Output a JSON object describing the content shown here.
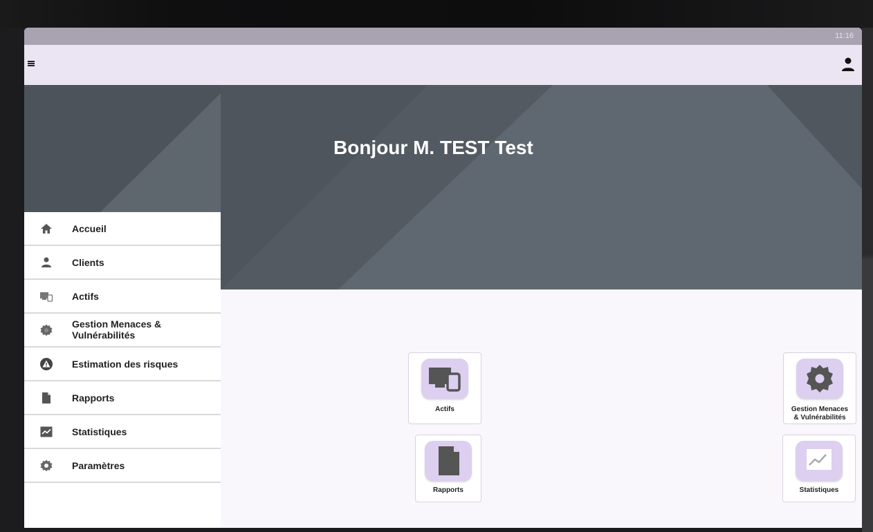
{
  "status_bar": {
    "time": "11:16"
  },
  "app_bar": {
    "menu_icon": "hamburger-menu-icon",
    "account_icon": "account-icon"
  },
  "hero": {
    "greeting": "Bonjour M. TEST Test"
  },
  "sidebar": {
    "items": [
      {
        "label": "Accueil",
        "icon": "home-icon"
      },
      {
        "label": "Clients",
        "icon": "person-icon"
      },
      {
        "label": "Actifs",
        "icon": "devices-icon"
      },
      {
        "label": "Gestion Menaces & Vulnérabilités",
        "icon": "bug-gear-icon"
      },
      {
        "label": "Estimation des risques",
        "icon": "warning-icon"
      },
      {
        "label": "Rapports",
        "icon": "document-icon"
      },
      {
        "label": "Statistiques",
        "icon": "chart-icon"
      },
      {
        "label": "Paramètres",
        "icon": "gear-icon"
      }
    ]
  },
  "tiles": [
    {
      "label": "Actifs",
      "icon": "devices-icon"
    },
    {
      "label_line1": "Gestion Menaces",
      "label_line2": "& Vulnérabilités",
      "icon": "gear-icon"
    },
    {
      "label": "Rapports",
      "icon": "document-icon"
    },
    {
      "label": "Statistiques",
      "icon": "chart-icon"
    }
  ],
  "colors": {
    "status_bar": "#a8a2b1",
    "app_bar": "#ebe5f3",
    "hero_bg": "#545b63",
    "tile_icon_bg": "#dccff0",
    "content_bg": "#faf7fc"
  }
}
